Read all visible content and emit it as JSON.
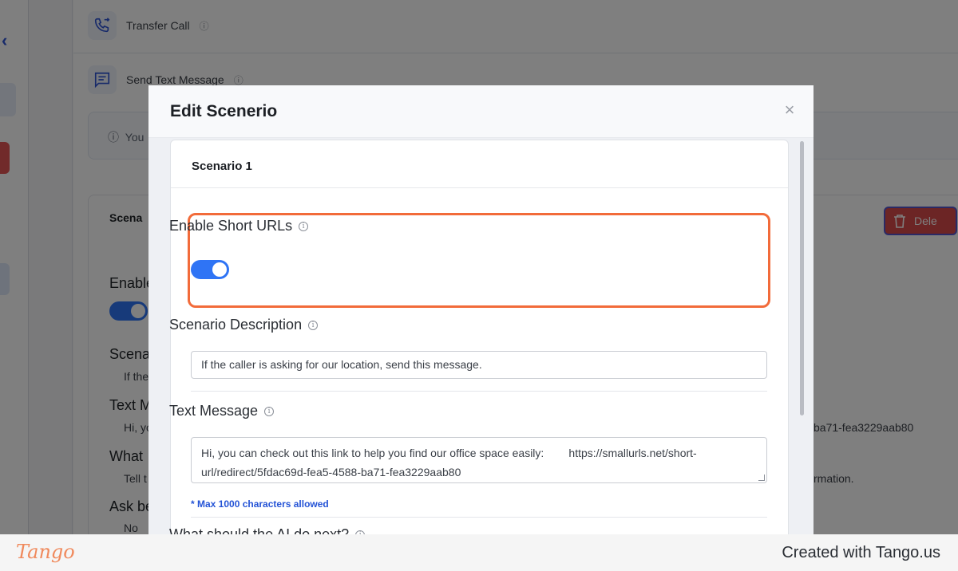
{
  "background": {
    "rows": [
      {
        "label": "Transfer Call"
      },
      {
        "label": "Send Text Message"
      }
    ],
    "notice_text": "You",
    "card": {
      "title": "Scena",
      "delete_label": "Dele",
      "enable_label": "Enable",
      "description_label": "Scena",
      "description_value": "If the",
      "text_label": "Text M",
      "text_value": "Hi, yo",
      "text_value_tail": "ba71-fea3229aab80",
      "what_label": "What",
      "what_value": "Tell t",
      "what_value_tail": "rmation.",
      "ask_label": "Ask be",
      "ask_value": "No"
    }
  },
  "modal": {
    "title": "Edit Scenerio",
    "close_symbol": "×",
    "scenario_title": "Scenario 1",
    "short_urls": {
      "label": "Enable Short URLs",
      "enabled": true
    },
    "description": {
      "label": "Scenario Description",
      "value": "If the caller is asking for our location, send this message."
    },
    "text_message": {
      "label": "Text Message",
      "value": "Hi, you can check out this link to help you find our office space easily:        https://smallurls.net/short-url/redirect/5fdac69d-fea5-4588-ba71-fea3229aab80",
      "char_note": "* Max 1000 characters allowed"
    },
    "next_label": "What should the AI do next?"
  },
  "footer": {
    "logo": "Tango",
    "credit": "Created with Tango.us"
  },
  "colors": {
    "accent": "#2f74f5",
    "highlight": "#f26b3a",
    "danger": "#d84b4b",
    "note": "#2453d6"
  },
  "icons": [
    "chevron-left-icon",
    "phone-transfer-icon",
    "message-icon",
    "info-icon",
    "trash-icon",
    "close-icon"
  ]
}
